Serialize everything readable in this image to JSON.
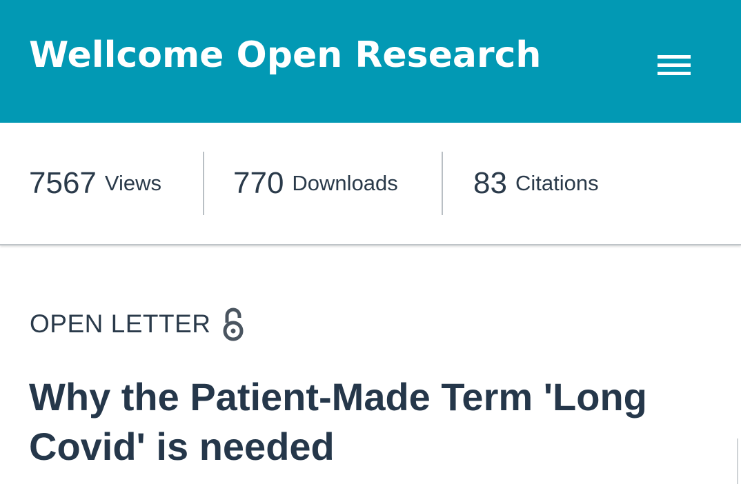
{
  "header": {
    "brand": "Wellcome Open Research",
    "menu_icon": "hamburger-menu-icon",
    "background_color": "#0299b4"
  },
  "metrics": {
    "views": {
      "value": "7567",
      "label": "Views"
    },
    "downloads": {
      "value": "770",
      "label": "Downloads"
    },
    "citations": {
      "value": "83",
      "label": "Citations"
    }
  },
  "article": {
    "type": "OPEN LETTER",
    "access_icon": "open-access-icon",
    "title": "Why the Patient-Made Term 'Long Covid' is needed"
  }
}
